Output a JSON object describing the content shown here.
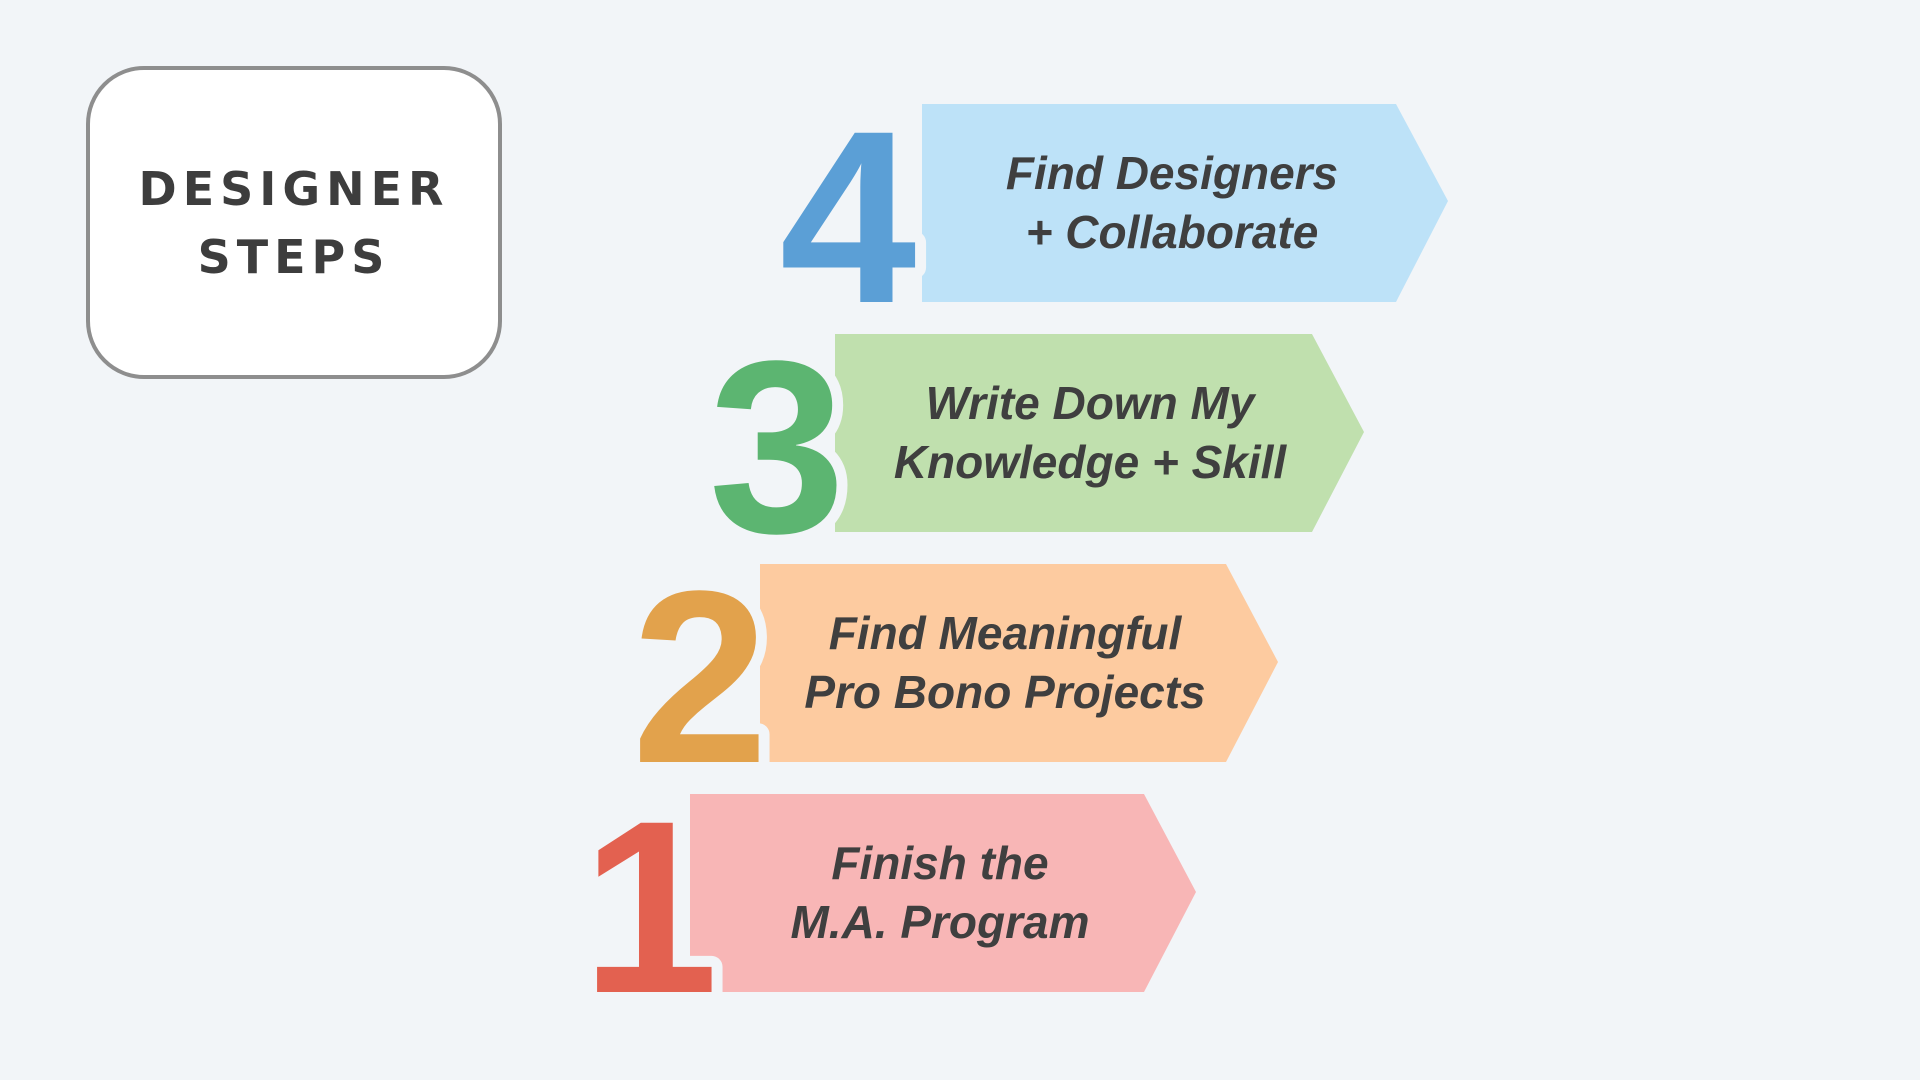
{
  "title": {
    "line1": "DESIGNER",
    "line2": "STEPS"
  },
  "steps": [
    {
      "number": "4",
      "line1": "Find Designers",
      "line2": "+ Collaborate",
      "number_color": "#5b9fd6",
      "band_color": "#bde2f8"
    },
    {
      "number": "3",
      "line1": "Write Down My",
      "line2": "Knowledge + Skill",
      "number_color": "#5cb571",
      "band_color": "#c0e0ae"
    },
    {
      "number": "2",
      "line1": "Find Meaningful",
      "line2": "Pro Bono Projects",
      "number_color": "#e2a24c",
      "band_color": "#fdcba0"
    },
    {
      "number": "1",
      "line1": "Finish the",
      "line2": "M.A. Program",
      "number_color": "#e36150",
      "band_color": "#f8b6b6"
    }
  ]
}
